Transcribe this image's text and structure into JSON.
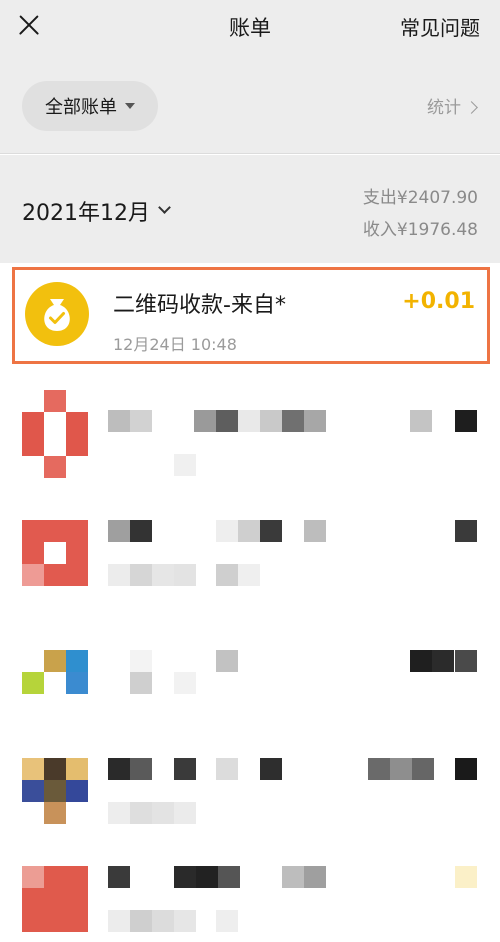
{
  "nav": {
    "title": "账单",
    "faq_label": "常见问题"
  },
  "filter": {
    "label": "全部账单",
    "stats_label": "统计"
  },
  "month": {
    "label": "2021年12月",
    "expense": "支出¥2407.90",
    "income": "收入¥1976.48"
  },
  "highlighted_transaction": {
    "title": "二维码收款-来自*",
    "time": "12月24日 10:48",
    "amount": "+0.01",
    "icon": "money-bag-check-icon"
  },
  "colors": {
    "accent_amount": "#f2b300",
    "highlight_border": "#ee7444",
    "coin_yellow": "#f2c00e",
    "page_gray": "#ededed"
  }
}
